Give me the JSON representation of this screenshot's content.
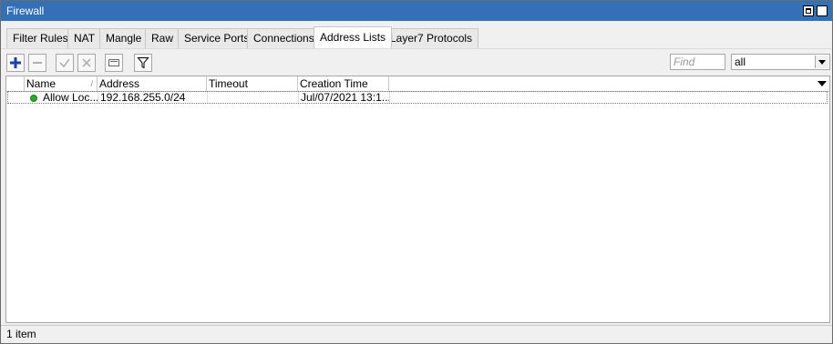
{
  "window": {
    "title": "Firewall"
  },
  "tabs": [
    {
      "label": "Filter Rules"
    },
    {
      "label": "NAT"
    },
    {
      "label": "Mangle"
    },
    {
      "label": "Raw"
    },
    {
      "label": "Service Ports"
    },
    {
      "label": "Connections"
    },
    {
      "label": "Address Lists",
      "active": true
    },
    {
      "label": "Layer7 Protocols"
    }
  ],
  "toolbar": {
    "icons": [
      "add-icon",
      "remove-icon",
      "enable-icon",
      "disable-icon",
      "comment-icon",
      "filter-icon"
    ],
    "find_placeholder": "Find",
    "filter_value": "all"
  },
  "table": {
    "columns": [
      "Name",
      "Address",
      "Timeout",
      "Creation Time"
    ],
    "rows": [
      {
        "status": "enabled",
        "name": "Allow Loc...",
        "address": "192.168.255.0/24",
        "timeout": "",
        "creation_time": "Jul/07/2021 13:1..."
      }
    ]
  },
  "status": {
    "count_text": "1 item"
  },
  "colors": {
    "titlebar": "#3470b8",
    "status_green": "#2fa52f",
    "add_blue": "#1a3fb0"
  }
}
